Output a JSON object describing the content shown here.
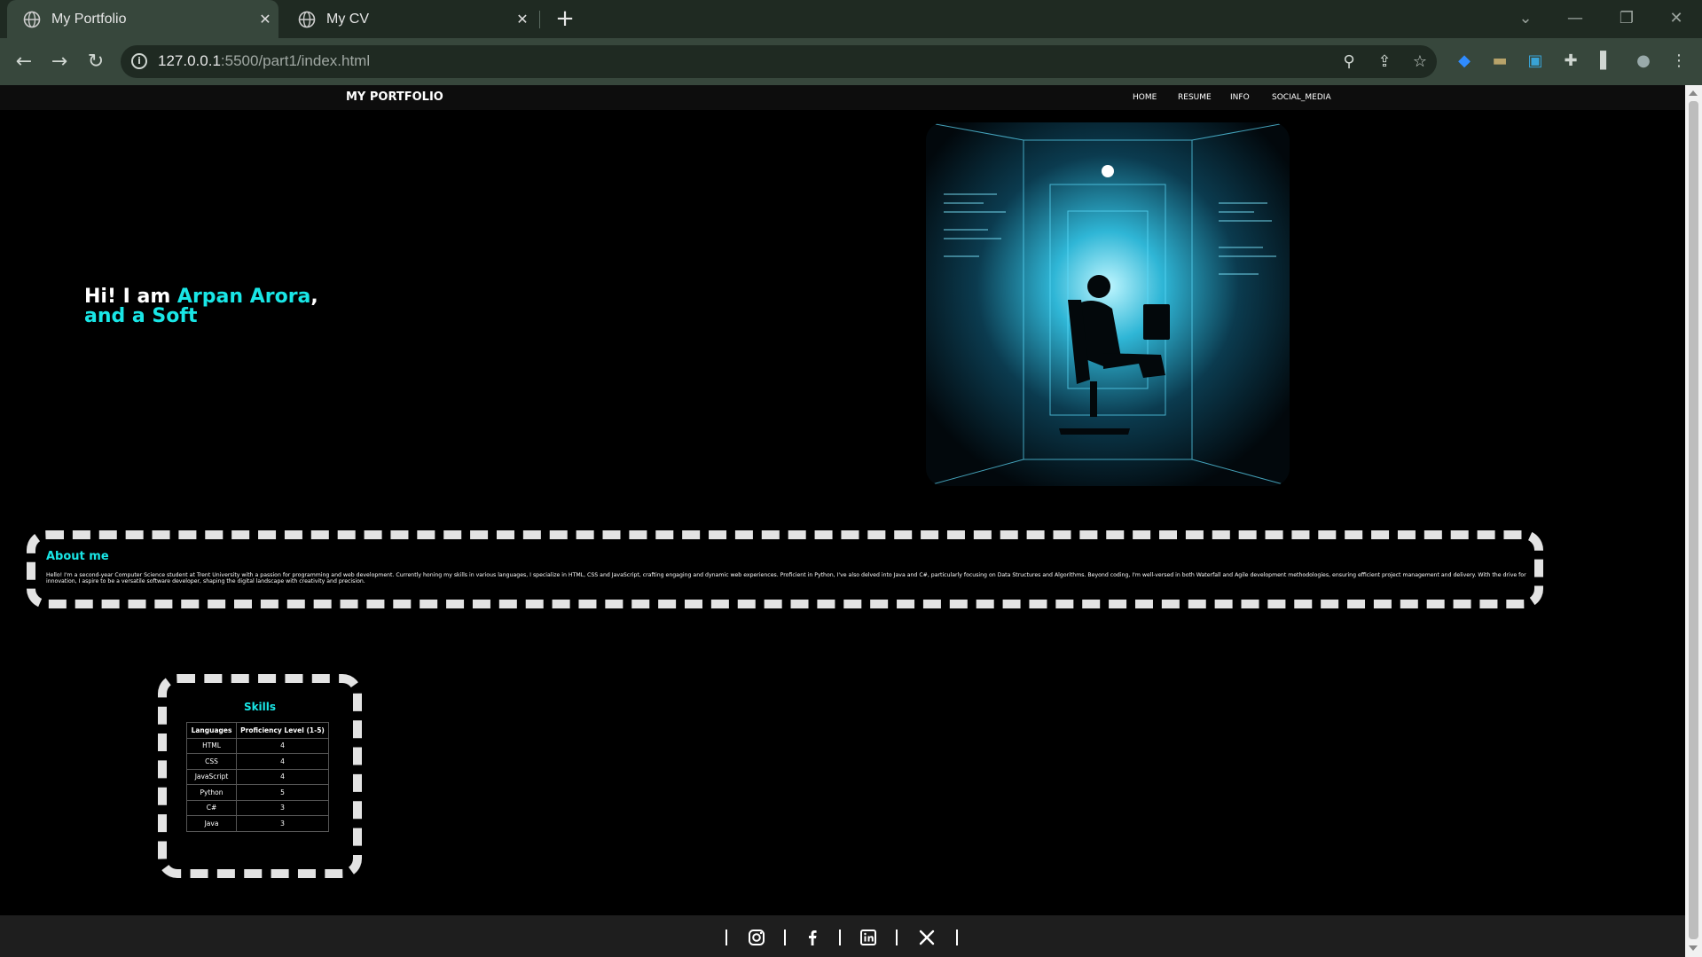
{
  "browser": {
    "tabs": [
      {
        "title": "My Portfolio",
        "active": true
      },
      {
        "title": "My CV",
        "active": false
      }
    ],
    "url_host": "127.0.0.1",
    "url_path": ":5500/part1/index.html",
    "new_tab_glyph": "+",
    "close_glyph": "✕"
  },
  "site": {
    "brand": "MY PORTFOLIO",
    "nav": [
      "HOME",
      "RESUME",
      "INFO",
      "SOCIAL_MEDIA"
    ],
    "greeting_prefix": "Hi! I am ",
    "greeting_name": "Arpan Arora",
    "greeting_comma": ",",
    "greeting_line2": "and a Soft",
    "about_title": "About me",
    "about_text": "Hello! I'm a second-year Computer Science student at Trent University with a passion for programming and web development. Currently honing my skills in various languages, I specialize in HTML, CSS and JavaScript, crafting engaging and dynamic web experiences. Proficient in Python, I've also delved into Java and C#, particularly focusing on Data Structures and Algorithms. Beyond coding, I'm well-versed in both Waterfall and Agile development methodologies, ensuring efficient project management and delivery. With the drive for innovation, I aspire to be a versatile software developer, shaping the digital landscape with creativity and precision.",
    "skills_title": "Skills",
    "skills_headers": [
      "Languages",
      "Proficiency Level (1-5)"
    ],
    "skills_rows": [
      [
        "HTML",
        "4"
      ],
      [
        "CSS",
        "4"
      ],
      [
        "JavaScript",
        "4"
      ],
      [
        "Python",
        "5"
      ],
      [
        "C#",
        "3"
      ],
      [
        "Java",
        "3"
      ]
    ],
    "social_icons": [
      "instagram-icon",
      "facebook-icon",
      "linkedin-icon",
      "x-twitter-icon"
    ]
  },
  "colors": {
    "accent": "#19e6e6",
    "page_bg": "#000000",
    "chrome_tabstrip": "#1f2a22",
    "chrome_toolbar": "#37473c"
  }
}
